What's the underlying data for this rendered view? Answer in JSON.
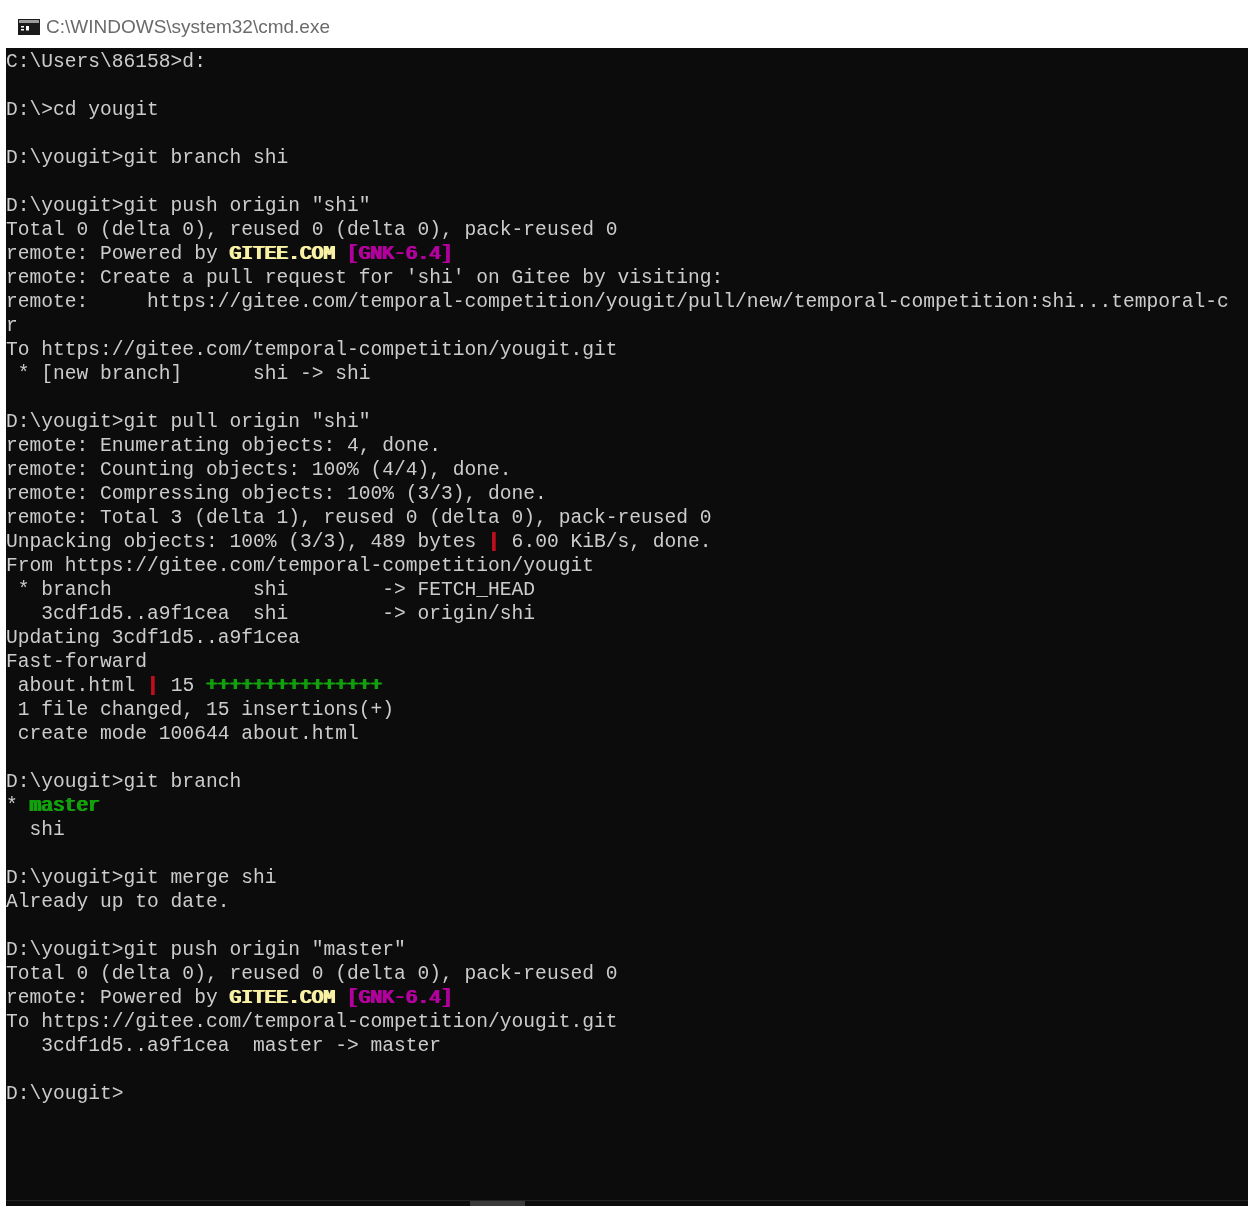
{
  "window": {
    "title": "C:\\WINDOWS\\system32\\cmd.exe"
  },
  "console": {
    "blocks": [
      {
        "lines": [
          {
            "spans": [
              {
                "text": "C:\\Users\\86158>d:"
              }
            ]
          }
        ]
      },
      {
        "lines": [
          {
            "spans": [
              {
                "text": "D:\\>cd yougit"
              }
            ]
          }
        ]
      },
      {
        "lines": [
          {
            "spans": [
              {
                "text": "D:\\yougit>git branch shi"
              }
            ]
          }
        ]
      },
      {
        "lines": [
          {
            "spans": [
              {
                "text": "D:\\yougit>git push origin \"shi\""
              }
            ]
          },
          {
            "spans": [
              {
                "text": "Total 0 (delta 0), reused 0 (delta 0), pack-reused 0"
              }
            ]
          },
          {
            "spans": [
              {
                "text": "remote: Powered by "
              },
              {
                "text": "GITEE.COM",
                "color": "#f9f1a5"
              },
              {
                "text": " [GNK-6.4]",
                "color": "#b4009e"
              }
            ]
          },
          {
            "spans": [
              {
                "text": "remote: Create a pull request for 'shi' on Gitee by visiting:"
              }
            ]
          },
          {
            "spans": [
              {
                "text": "remote:     https://gitee.com/temporal-competition/yougit/pull/new/temporal-competition:shi...temporal-c"
              }
            ]
          },
          {
            "spans": [
              {
                "text": "r"
              }
            ]
          },
          {
            "spans": [
              {
                "text": "To https://gitee.com/temporal-competition/yougit.git"
              }
            ]
          },
          {
            "spans": [
              {
                "text": " * [new branch]      shi -> shi"
              }
            ]
          }
        ]
      },
      {
        "lines": [
          {
            "spans": [
              {
                "text": "D:\\yougit>git pull origin \"shi\""
              }
            ]
          },
          {
            "spans": [
              {
                "text": "remote: Enumerating objects: 4, done."
              }
            ]
          },
          {
            "spans": [
              {
                "text": "remote: Counting objects: 100% (4/4), done."
              }
            ]
          },
          {
            "spans": [
              {
                "text": "remote: Compressing objects: 100% (3/3), done."
              }
            ]
          },
          {
            "spans": [
              {
                "text": "remote: Total 3 (delta 1), reused 0 (delta 0), pack-reused 0"
              }
            ]
          },
          {
            "spans": [
              {
                "text": "Unpacking objects: 100% (3/3), 489 bytes "
              },
              {
                "text": "|",
                "color": "#c50f1f"
              },
              {
                "text": " 6.00 KiB/s, done."
              }
            ]
          },
          {
            "spans": [
              {
                "text": "From https://gitee.com/temporal-competition/yougit"
              }
            ]
          },
          {
            "spans": [
              {
                "text": " * branch            shi        -> FETCH_HEAD"
              }
            ]
          },
          {
            "spans": [
              {
                "text": "   3cdf1d5..a9f1cea  shi        -> origin/shi"
              }
            ]
          },
          {
            "spans": [
              {
                "text": "Updating 3cdf1d5..a9f1cea"
              }
            ]
          },
          {
            "spans": [
              {
                "text": "Fast-forward"
              }
            ]
          },
          {
            "spans": [
              {
                "text": " about.html "
              },
              {
                "text": "|",
                "color": "#c50f1f"
              },
              {
                "text": " 15 "
              },
              {
                "text": "+++++++++++++++",
                "color": "#13a10e"
              }
            ]
          },
          {
            "spans": [
              {
                "text": " 1 file changed, 15 insertions(+)"
              }
            ]
          },
          {
            "spans": [
              {
                "text": " create mode 100644 about.html"
              }
            ]
          }
        ]
      },
      {
        "lines": [
          {
            "spans": [
              {
                "text": "D:\\yougit>git branch"
              }
            ]
          },
          {
            "spans": [
              {
                "text": "* "
              },
              {
                "text": "master",
                "color": "#13a10e"
              }
            ]
          },
          {
            "spans": [
              {
                "text": "  shi"
              }
            ]
          }
        ]
      },
      {
        "lines": [
          {
            "spans": [
              {
                "text": "D:\\yougit>git merge shi"
              }
            ]
          },
          {
            "spans": [
              {
                "text": "Already up to date."
              }
            ]
          }
        ]
      },
      {
        "lines": [
          {
            "spans": [
              {
                "text": "D:\\yougit>git push origin \"master\""
              }
            ]
          },
          {
            "spans": [
              {
                "text": "Total 0 (delta 0), reused 0 (delta 0), pack-reused 0"
              }
            ]
          },
          {
            "spans": [
              {
                "text": "remote: Powered by "
              },
              {
                "text": "GITEE.COM",
                "color": "#f9f1a5"
              },
              {
                "text": " [GNK-6.4]",
                "color": "#b4009e"
              }
            ]
          },
          {
            "spans": [
              {
                "text": "To https://gitee.com/temporal-competition/yougit.git"
              }
            ]
          },
          {
            "spans": [
              {
                "text": "   3cdf1d5..a9f1cea  master -> master"
              }
            ]
          }
        ]
      },
      {
        "lines": [
          {
            "spans": [
              {
                "text": "D:\\yougit>"
              }
            ]
          }
        ]
      }
    ]
  }
}
